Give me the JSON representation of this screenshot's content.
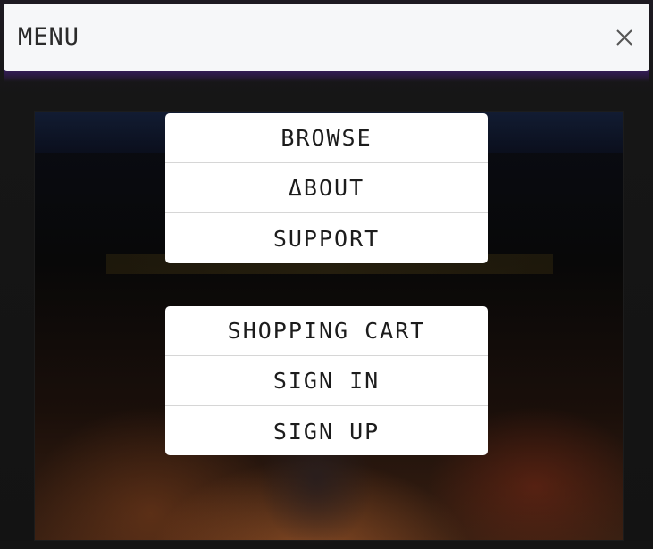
{
  "header": {
    "title": "MENU",
    "close_icon": "close-icon"
  },
  "nav_group": {
    "items": [
      {
        "label": "BROWSE"
      },
      {
        "label": "ΔBOUT"
      },
      {
        "label": "SUPPORT"
      }
    ]
  },
  "account_group": {
    "items": [
      {
        "label": "SHOPPING CART"
      },
      {
        "label": "SIGN IN"
      },
      {
        "label": "SIGN UP"
      }
    ]
  },
  "colors": {
    "header_bg": "#f6f7f9",
    "item_bg": "#ffffff",
    "accent_strip": "#3e1f6e",
    "text": "#1c1c1c"
  }
}
